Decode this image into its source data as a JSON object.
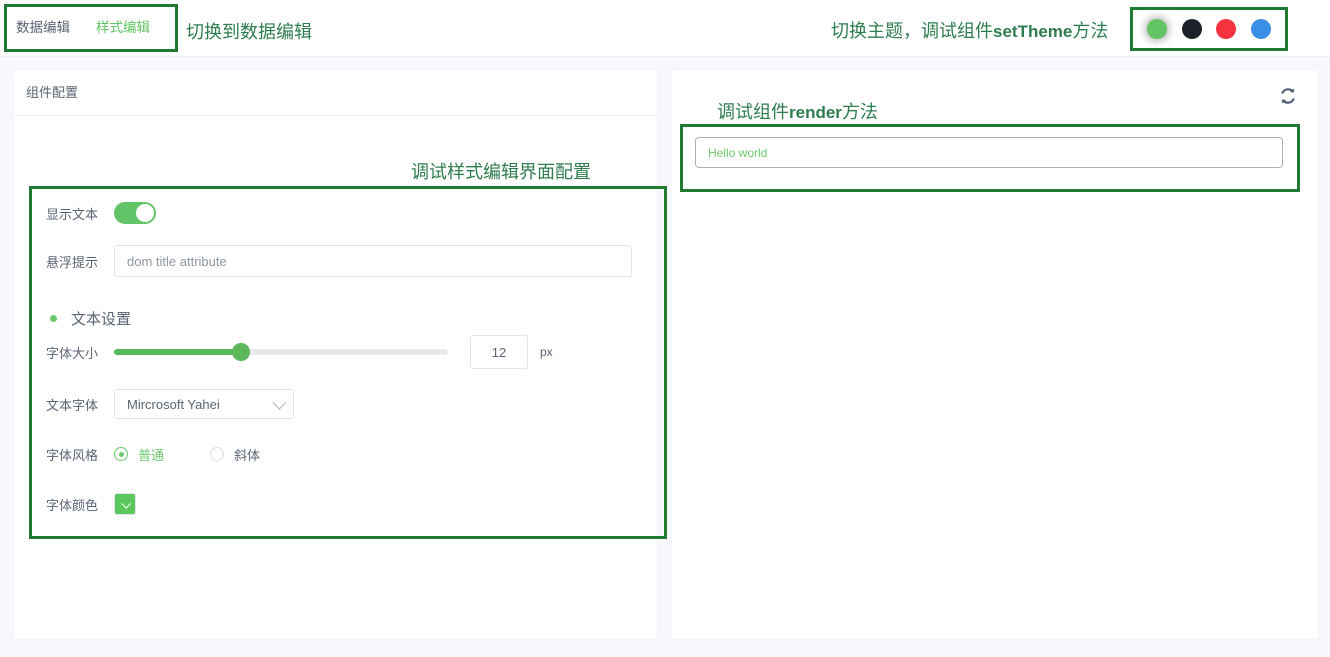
{
  "topbar": {
    "tabs": [
      {
        "label": "数据编辑",
        "active": false,
        "name": "tab-data-edit"
      },
      {
        "label": "样式编辑",
        "active": true,
        "name": "tab-style-edit"
      }
    ],
    "annotation_switch_to_data": "切换到数据编辑",
    "annotation_set_theme_pre": "切换主题，调试组件",
    "annotation_set_theme_em": "setTheme",
    "annotation_set_theme_post": "方法",
    "theme_dots": [
      {
        "name": "theme-dot-green",
        "color": "#62c462",
        "selected": true
      },
      {
        "name": "theme-dot-black",
        "color": "#1d2129",
        "selected": false
      },
      {
        "name": "theme-dot-red",
        "color": "#f5333f",
        "selected": false
      },
      {
        "name": "theme-dot-blue",
        "color": "#3a8ee6",
        "selected": false
      }
    ]
  },
  "left_panel": {
    "title": "组件配置",
    "annotation": "调试样式编辑界面配置",
    "show_text": {
      "label": "显示文本",
      "value": true
    },
    "tooltip": {
      "label": "悬浮提示",
      "value": "",
      "placeholder": "dom title attribute"
    },
    "section_text_settings": {
      "title": "文本设置"
    },
    "font_size": {
      "label": "字体大小",
      "value": "12",
      "unit": "px",
      "min": 0,
      "max": 40,
      "fill_percent": 38
    },
    "font_face": {
      "label": "文本字体",
      "value": "Mircrosoft Yahei",
      "options": [
        "Mircrosoft Yahei"
      ]
    },
    "font_style": {
      "label": "字体风格",
      "options": [
        {
          "label": "普通",
          "checked": true
        },
        {
          "label": "斜体",
          "checked": false
        }
      ]
    },
    "font_color": {
      "label": "字体颜色",
      "value": "#5cc75c"
    }
  },
  "right_panel": {
    "annotation": "调试组件render方法",
    "annotation_pre": "调试组件",
    "annotation_em": "render",
    "annotation_post": "方法",
    "refresh_icon": "refresh-icon",
    "render_output": {
      "text": "Hello world",
      "color": "#6dc96d"
    }
  },
  "theme": {
    "accent": "#62c462",
    "annotation_box_border": "#217a32",
    "annotation_text": "#2e7d4f",
    "page_background": "#f7f8fc"
  }
}
